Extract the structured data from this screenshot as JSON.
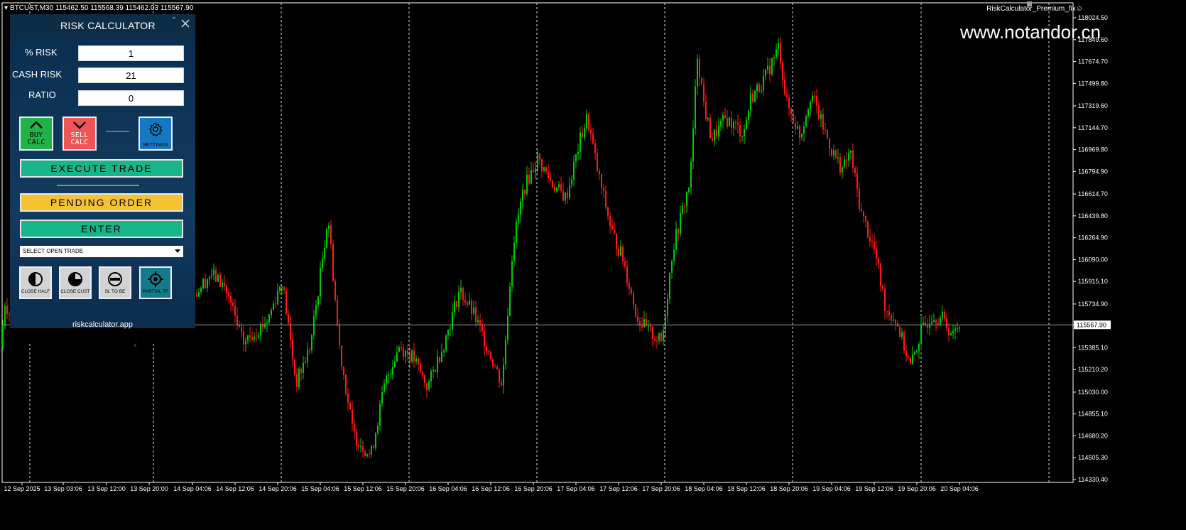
{
  "chart": {
    "symbol_info": "BTCUST,M30  115462.50 115568.39 115462.03 115567.90",
    "ea_label": "RiskCalculator_Premium_fix",
    "watermark": "www.notandor.cn",
    "current_price": "115567.90",
    "price_axis": [
      "118024.50",
      "117849.60",
      "117674.70",
      "117499.80",
      "117319.60",
      "117144.70",
      "116969.80",
      "116794.90",
      "116614.70",
      "116439.80",
      "116264.90",
      "116090.00",
      "115915.10",
      "115734.90",
      "115567.90",
      "115385.10",
      "115210.20",
      "115030.00",
      "114855.10",
      "114680.20",
      "114505.30",
      "114330.40"
    ],
    "time_axis": [
      "12 Sep 2025",
      "13 Sep 03:06",
      "13 Sep 12:00",
      "13 Sep 20:00",
      "14 Sep 04:06",
      "14 Sep 12:06",
      "14 Sep 20:06",
      "15 Sep 04:06",
      "15 Sep 12:06",
      "15 Sep 20:06",
      "16 Sep 04:06",
      "16 Sep 12:06",
      "16 Sep 20:06",
      "17 Sep 04:06",
      "17 Sep 12:06",
      "17 Sep 20:06",
      "18 Sep 04:06",
      "18 Sep 12:06",
      "18 Sep 20:06",
      "19 Sep 04:06",
      "19 Sep 12:06",
      "19 Sep 20:06",
      "20 Sep 04:06"
    ],
    "colors": {
      "bull": "#00cc00",
      "bear": "#ff1a1a",
      "background": "#000000"
    }
  },
  "panel": {
    "title": "RISK CALCULATOR",
    "fields": [
      {
        "label": "% RISK",
        "value": "1"
      },
      {
        "label": "CASH RISK",
        "value": "21"
      },
      {
        "label": "RATIO",
        "value": "0"
      }
    ],
    "buy_line1": "BUY",
    "buy_line2": "CALC",
    "sell_line1": "SELL",
    "sell_line2": "CALC",
    "settings_label": "SETTINGS",
    "execute_label": "EXECUTE TRADE",
    "pending_label": "PENDING ORDER",
    "enter_label": "ENTER",
    "select_value": "SELECT OPEN TRADE",
    "close_half_label": "CLOSE HALF",
    "close_cust_label": "CLOSE CUST",
    "sl_be_label": "SL TO BE",
    "partial_tp_label": "PARTIAL TP",
    "site": "riskcalculator.app",
    "colors": {
      "buy": "#20b34a",
      "sell": "#f05454",
      "settings": "#1677c2",
      "execute": "#18b48a",
      "pending": "#f5c232",
      "partial": "#157a8c"
    }
  }
}
